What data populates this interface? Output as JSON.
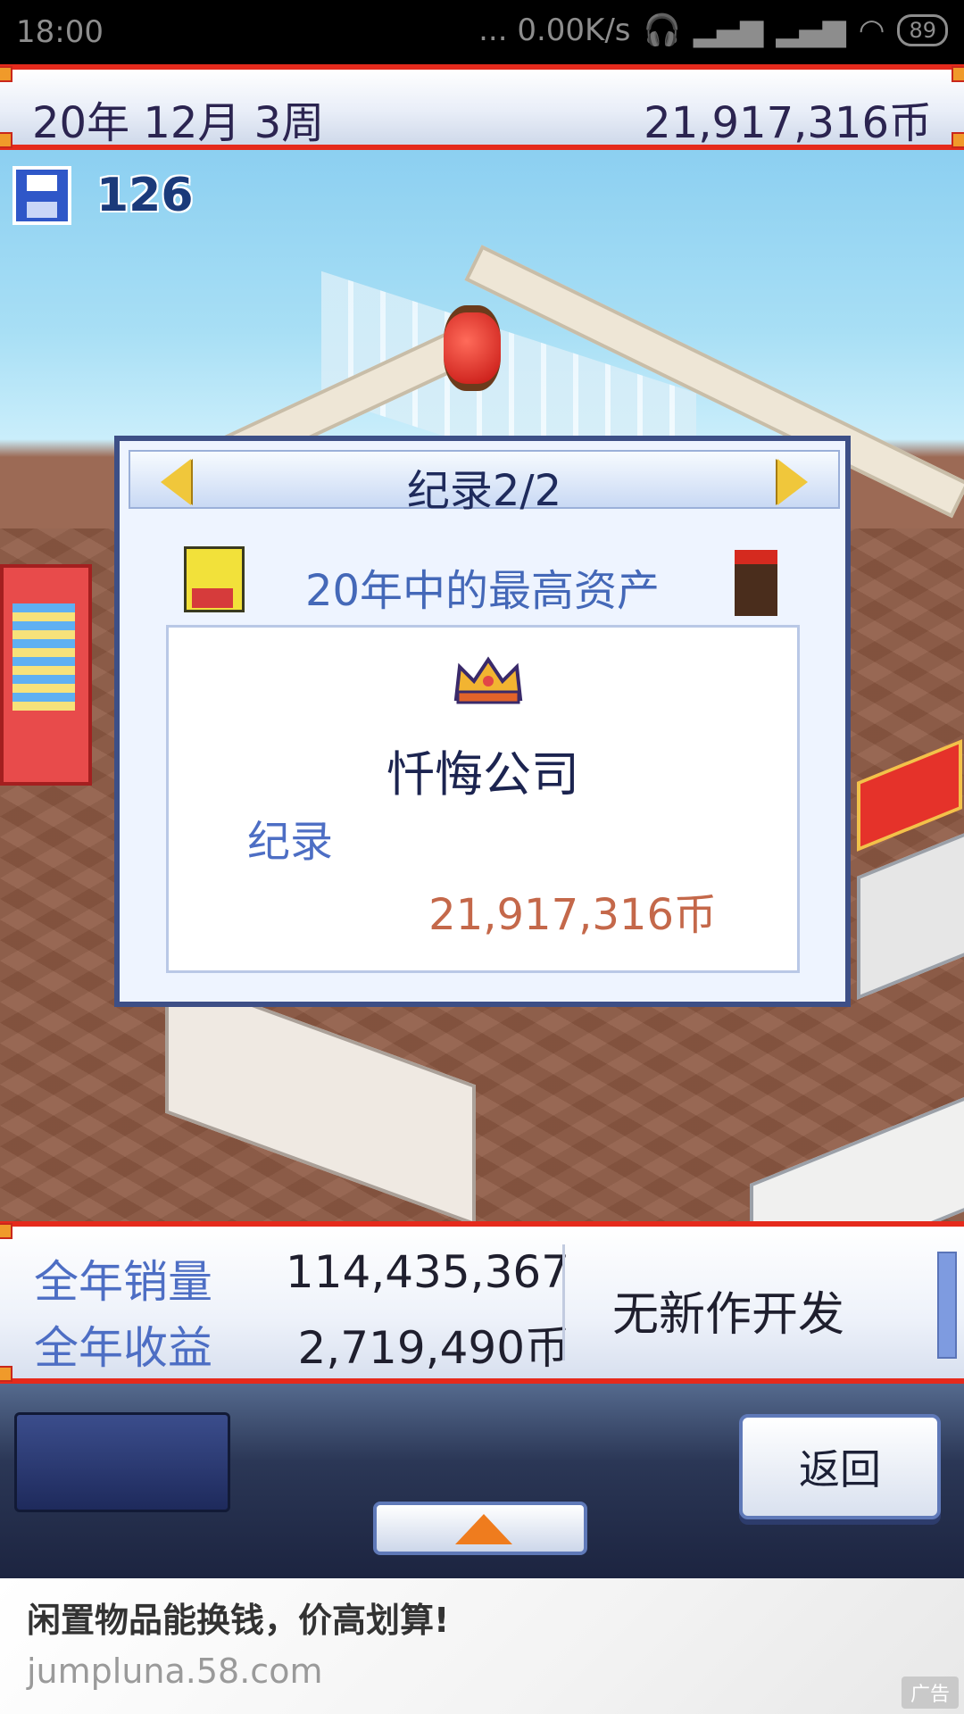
{
  "status_bar": {
    "time": "18:00",
    "network_speed": "... 0.00K/s",
    "battery": "89"
  },
  "top_bar": {
    "date": "20年 12月 3周",
    "funds": "21,917,316币"
  },
  "save": {
    "count": "126"
  },
  "record_dialog": {
    "title": "纪录2/2",
    "heading": "20年中的最高资产",
    "company": "忏悔公司",
    "record_label": "纪录",
    "record_value": "21,917,316币"
  },
  "stats": {
    "annual_sales_label": "全年销量",
    "annual_sales_value": "114,435,367",
    "annual_profit_label": "全年收益",
    "annual_profit_value": "2,719,490币",
    "dev_status": "无新作开发"
  },
  "controls": {
    "back_label": "返回"
  },
  "ad": {
    "title": "闲置物品能换钱，价高划算!",
    "url": "jumpluna.58.com",
    "badge": "广告"
  },
  "colors": {
    "accent_red": "#e52a1c",
    "dialog_border": "#3d4f86",
    "record_value": "#c4684a",
    "label_blue": "#4d6ec4"
  }
}
